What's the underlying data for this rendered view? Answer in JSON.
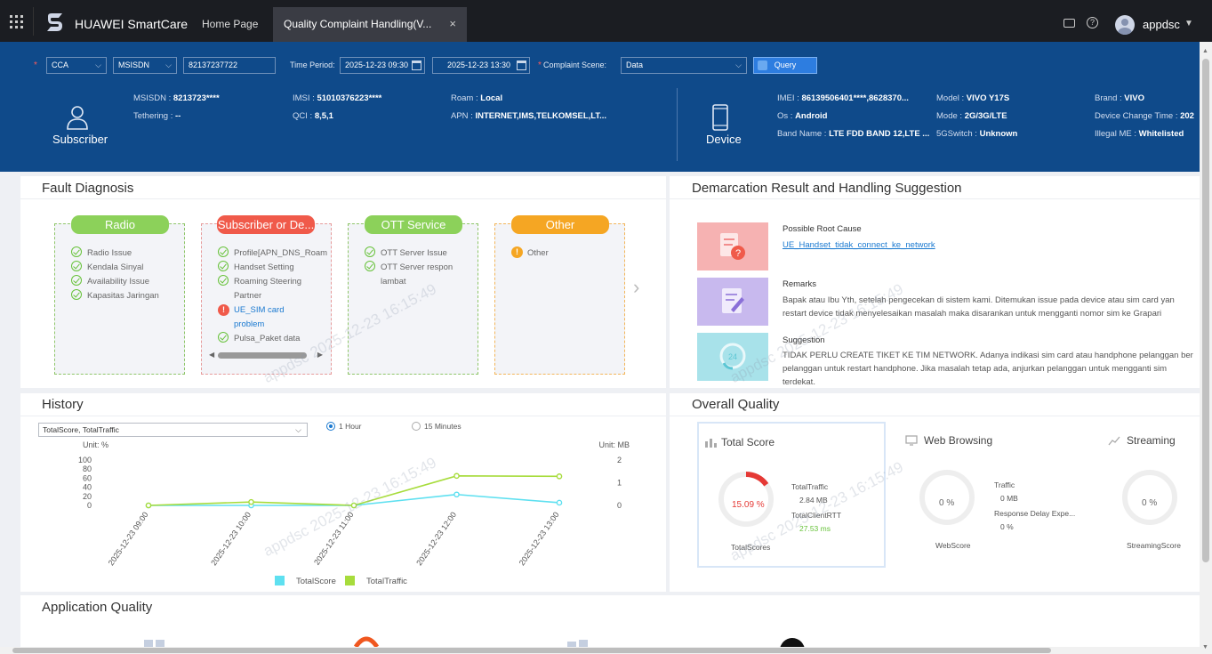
{
  "topbar": {
    "brand": "HUAWEI SmartCare",
    "tabs": [
      {
        "label": "Home Page"
      },
      {
        "label": "Quality Complaint Handling(V..."
      }
    ],
    "tab_close": "×",
    "user": "appdsc"
  },
  "query": {
    "type_value": "CCA",
    "id_type_value": "MSISDN",
    "number_value": "82137237722",
    "time_period_label": "Time Period:",
    "time_start": "2025-12-23 09:30",
    "time_end": "2025-12-23 13:30",
    "scene_label": "Complaint Scene:",
    "scene_value": "Data",
    "query_button": "Query"
  },
  "subscriber": {
    "label": "Subscriber",
    "fields": [
      {
        "k": "MSISDN",
        "v": "8213723****"
      },
      {
        "k": "Tethering",
        "v": "--"
      },
      {
        "k": "IMSI",
        "v": "51010376223****"
      },
      {
        "k": "QCI",
        "v": "8,5,1"
      },
      {
        "k": "Roam",
        "v": "Local"
      },
      {
        "k": "APN",
        "v": "INTERNET,IMS,TELKOMSEL,LT..."
      }
    ]
  },
  "device": {
    "label": "Device",
    "fields": [
      {
        "k": "IMEI",
        "v": "86139506401****,8628370..."
      },
      {
        "k": "Os",
        "v": "Android"
      },
      {
        "k": "Band Name",
        "v": "LTE FDD BAND 12,LTE ..."
      },
      {
        "k": "Model",
        "v": "VIVO Y17S"
      },
      {
        "k": "Mode",
        "v": "2G/3G/LTE"
      },
      {
        "k": "5GSwitch",
        "v": "Unknown"
      },
      {
        "k": "Brand",
        "v": "VIVO"
      },
      {
        "k": "Device Change Time",
        "v": "202"
      },
      {
        "k": "Illegal ME",
        "v": "Whitelisted"
      }
    ]
  },
  "fault": {
    "title": "Fault Diagnosis",
    "cards": [
      {
        "name": "Radio",
        "items": [
          "Radio Issue",
          "Kendala Sinyal",
          "Availability Issue",
          "Kapasitas Jaringan"
        ]
      },
      {
        "name": "Subscriber or De...",
        "items": [
          "Profile[APN_DNS_Roam",
          "Handset Setting",
          "Roaming Steering",
          "Partner",
          "UE_SIM card",
          "problem",
          "Pulsa_Paket data"
        ]
      },
      {
        "name": "OTT Service",
        "items": [
          "OTT Server Issue",
          "OTT Server respon",
          "lambat"
        ]
      },
      {
        "name": "Other",
        "items": [
          "Other"
        ]
      }
    ],
    "colors": {
      "green": "#8cd15a",
      "red": "#f05a4a",
      "orange": "#f5a623"
    }
  },
  "demarcation": {
    "title": "Demarcation Result and Handling Suggestion",
    "root_cause_title": "Possible Root Cause",
    "root_cause_link": "UE_Handset_tidak_connect_ke_network",
    "remarks_title": "Remarks",
    "remarks_text_1": "Bapak atau Ibu Yth, setelah pengecekan di sistem kami. Ditemukan issue pada device atau sim card yan",
    "remarks_text_2": "restart device tidak menyelesaikan masalah maka disarankan untuk mengganti nomor sim ke Grapari",
    "suggestion_title": "Suggestion",
    "suggestion_text_1": "TIDAK PERLU CREATE TIKET KE TIM NETWORK. Adanya indikasi sim card atau handphone pelanggan ber",
    "suggestion_text_2": "pelanggan untuk restart handphone. Jika masalah tetap ada, anjurkan pelanggan untuk mengganti sim",
    "suggestion_text_3": "terdekat."
  },
  "history": {
    "title": "History",
    "select_value": "TotalScore, TotalTraffic",
    "radio_1": "1 Hour",
    "radio_2": "15 Minutes"
  },
  "chart_data": {
    "type": "line",
    "x": [
      "2025-12-23 09:00",
      "2025-12-23 10:00",
      "2025-12-23 11:00",
      "2025-12-23 12:00",
      "2025-12-23 13:00"
    ],
    "series": [
      {
        "name": "TotalScore",
        "axis": "left",
        "color": "#5ee0f0",
        "values": [
          0,
          0,
          0,
          24,
          6
        ]
      },
      {
        "name": "TotalTraffic",
        "axis": "right",
        "color": "#a7dc3c",
        "values": [
          0,
          0.15,
          0,
          1.3,
          1.28
        ]
      }
    ],
    "y_left": {
      "unit": "Unit: %",
      "ticks": [
        0,
        20,
        40,
        60,
        80,
        100
      ],
      "ylim": [
        0,
        100
      ]
    },
    "y_right": {
      "unit": "Unit: MB",
      "ticks": [
        0,
        1,
        2
      ],
      "ylim": [
        0,
        2
      ]
    },
    "legend_position": "bottom",
    "grid": false
  },
  "overall": {
    "title": "Overall Quality",
    "total": {
      "title": "Total Score",
      "pct": "15.09 %",
      "ratio": 0.1509,
      "metric1": "TotalTraffic",
      "val1": "2.84 MB",
      "metric2": "TotalClientRTT",
      "val2": "27.53 ms",
      "caption": "TotalScores"
    },
    "web": {
      "title": "Web Browsing",
      "pct": "0 %",
      "metric1": "Traffic",
      "val1": "0 MB",
      "metric2": "Response Delay Expe...",
      "val2": "0 %",
      "caption": "WebScore"
    },
    "streaming": {
      "title": "Streaming",
      "pct": "0 %",
      "caption": "StreamingScore"
    }
  },
  "app_quality": {
    "title": "Application Quality"
  },
  "watermark": "appdsc 2025-12-23 16:15:49"
}
